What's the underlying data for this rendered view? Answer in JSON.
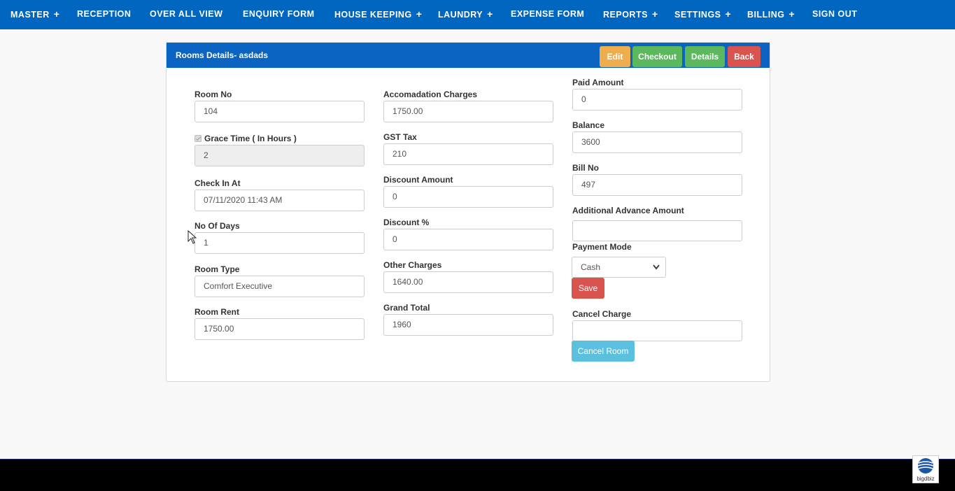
{
  "nav": {
    "items": [
      {
        "label": "MASTER",
        "plus": "+"
      },
      {
        "label": "RECEPTION",
        "plus": ""
      },
      {
        "label": "OVER ALL VIEW",
        "plus": ""
      },
      {
        "label": "ENQUIRY FORM",
        "plus": ""
      },
      {
        "label": "HOUSE KEEPING",
        "plus": "+"
      },
      {
        "label": "LAUNDRY",
        "plus": "+"
      },
      {
        "label": "EXPENSE FORM",
        "plus": ""
      },
      {
        "label": "REPORTS",
        "plus": "+"
      },
      {
        "label": "SETTINGS",
        "plus": "+"
      },
      {
        "label": "BILLING",
        "plus": "+"
      },
      {
        "label": "SIGN OUT",
        "plus": ""
      }
    ]
  },
  "panel": {
    "title": "Rooms Details- asdads",
    "buttons": {
      "edit": "Edit",
      "checkout": "Checkout",
      "details": "Details",
      "back": "Back"
    }
  },
  "form": {
    "room_no": {
      "label": "Room No",
      "value": "104"
    },
    "grace_time": {
      "label": "Grace Time ( In Hours )",
      "value": "2"
    },
    "check_in_at": {
      "label": "Check In At",
      "value": "07/11/2020 11:43 AM"
    },
    "no_of_days": {
      "label": "No Of Days",
      "value": "1"
    },
    "room_type": {
      "label": "Room Type",
      "value": "Comfort Executive"
    },
    "room_rent": {
      "label": "Room Rent",
      "value": "1750.00"
    },
    "accommodation_charges": {
      "label": "Accomadation Charges",
      "value": "1750.00"
    },
    "gst_tax": {
      "label": "GST Tax",
      "value": "210"
    },
    "discount_amount": {
      "label": "Discount Amount",
      "value": "0"
    },
    "discount_percent": {
      "label": "Discount %",
      "value": "0"
    },
    "other_charges": {
      "label": "Other Charges",
      "value": "1640.00"
    },
    "grand_total": {
      "label": "Grand Total",
      "value": "1960"
    },
    "paid_amount": {
      "label": "Paid Amount",
      "value": "0"
    },
    "balance": {
      "label": "Balance",
      "value": "3600"
    },
    "bill_no": {
      "label": "Bill No",
      "value": "497"
    },
    "additional_advance": {
      "label": "Additional Advance Amount",
      "value": ""
    },
    "payment_mode": {
      "label": "Payment Mode",
      "value": "Cash"
    },
    "save_label": "Save",
    "cancel_charge": {
      "label": "Cancel Charge",
      "value": ""
    },
    "cancel_room_label": "Cancel Room"
  },
  "branding": {
    "logo_text": "bigdbiz"
  },
  "colors": {
    "nav_bg": "#0066c0",
    "panel_header": "#0b64c2",
    "edit": "#f0ad4e",
    "success": "#5cb85c",
    "danger": "#d9534f",
    "info": "#5bc0de"
  }
}
